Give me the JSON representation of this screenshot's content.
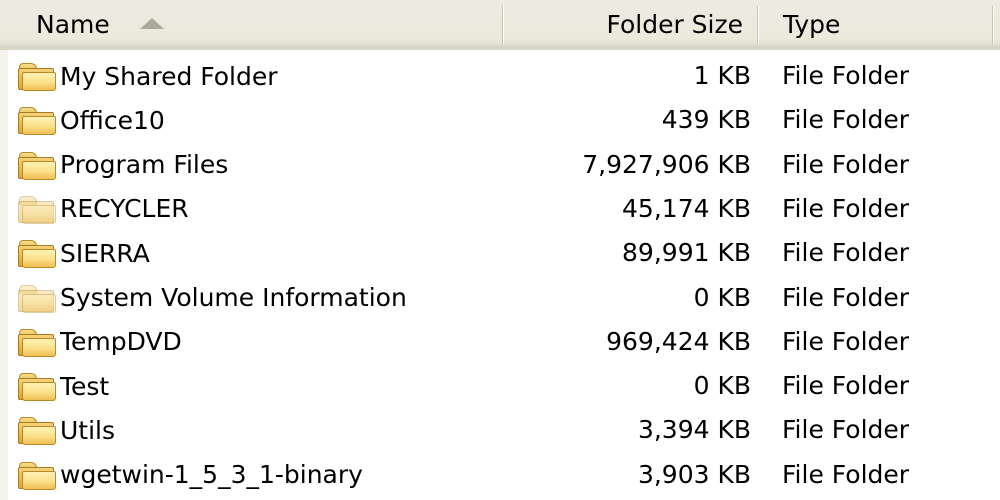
{
  "columns": {
    "name": "Name",
    "size": "Folder Size",
    "type": "Type",
    "sorted_by": "name",
    "sort_direction": "ascending"
  },
  "rows": [
    {
      "name": "My Shared Folder",
      "size": "1 KB",
      "type": "File Folder",
      "icon": "folder-icon",
      "hidden": false
    },
    {
      "name": "Office10",
      "size": "439 KB",
      "type": "File Folder",
      "icon": "folder-icon",
      "hidden": false
    },
    {
      "name": "Program Files",
      "size": "7,927,906 KB",
      "type": "File Folder",
      "icon": "folder-icon",
      "hidden": false
    },
    {
      "name": "RECYCLER",
      "size": "45,174 KB",
      "type": "File Folder",
      "icon": "folder-icon",
      "hidden": true
    },
    {
      "name": "SIERRA",
      "size": "89,991 KB",
      "type": "File Folder",
      "icon": "folder-icon",
      "hidden": false
    },
    {
      "name": "System Volume Information",
      "size": "0 KB",
      "type": "File Folder",
      "icon": "folder-icon",
      "hidden": true
    },
    {
      "name": "TempDVD",
      "size": "969,424 KB",
      "type": "File Folder",
      "icon": "folder-icon",
      "hidden": false
    },
    {
      "name": "Test",
      "size": "0 KB",
      "type": "File Folder",
      "icon": "folder-icon",
      "hidden": false
    },
    {
      "name": "Utils",
      "size": "3,394 KB",
      "type": "File Folder",
      "icon": "folder-icon",
      "hidden": false
    },
    {
      "name": "wgetwin-1_5_3_1-binary",
      "size": "3,903 KB",
      "type": "File Folder",
      "icon": "folder-icon",
      "hidden": false
    }
  ],
  "colors": {
    "header_bg": "#ebeadb",
    "sort_arrow": "#aca899",
    "folder_yellow": "#fbe08a",
    "text": "#000000"
  }
}
